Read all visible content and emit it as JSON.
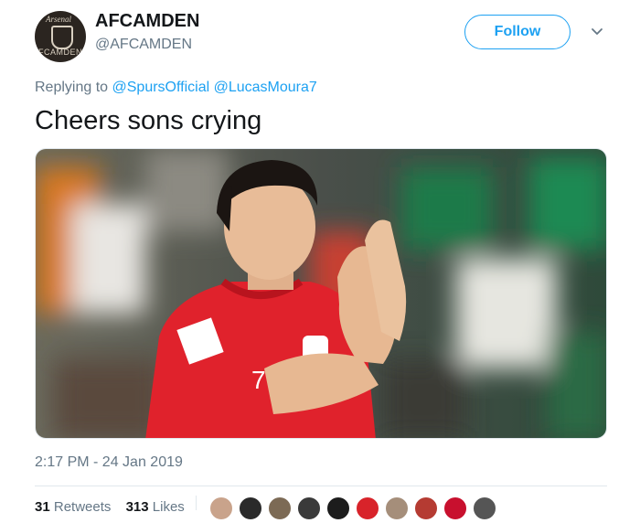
{
  "tweet": {
    "avatar_text_bottom": "FCAMDEN",
    "avatar_text_top": "Arsenal",
    "display_name": "AFCAMDEN",
    "handle": "@AFCAMDEN",
    "follow_label": "Follow",
    "replying_prefix": "Replying to",
    "reply_mentions": [
      "@SpursOfficial",
      "@LucasMoura7"
    ],
    "text": "Cheers sons crying",
    "photo_jersey_number": "7",
    "timestamp": "2:17 PM - 24 Jan 2019",
    "retweets_count": "31",
    "retweets_label": "Retweets",
    "likes_count": "313",
    "likes_label": "Likes"
  },
  "colors": {
    "accent": "#1da1f2",
    "muted": "#657786",
    "jersey": "#e0222c"
  },
  "icons": {
    "chevron": "chevron-down-icon"
  },
  "likers": [
    {
      "color": "#c9a38b"
    },
    {
      "color": "#2a2a2a"
    },
    {
      "color": "#7c6a55"
    },
    {
      "color": "#3a3a3a"
    },
    {
      "color": "#1c1c1c"
    },
    {
      "color": "#d8232a"
    },
    {
      "color": "#a58e7a"
    },
    {
      "color": "#b53b32"
    },
    {
      "color": "#c8102e"
    },
    {
      "color": "#555555"
    }
  ]
}
